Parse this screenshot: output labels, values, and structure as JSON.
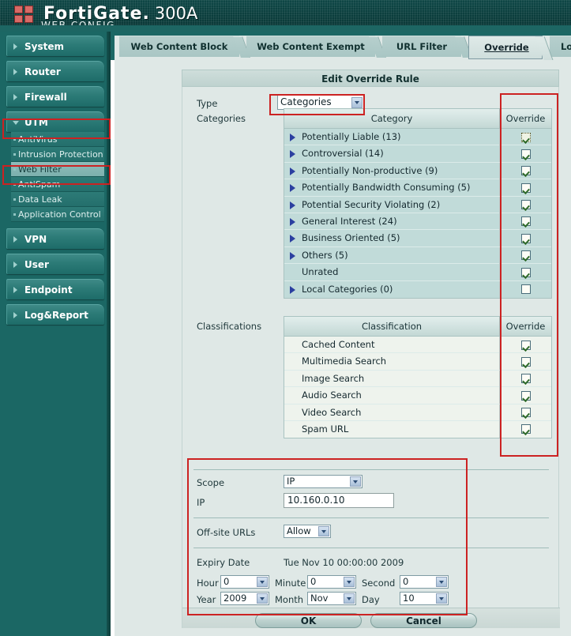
{
  "banner": {
    "brand": "FortiGate.",
    "model": "300A",
    "subtitle": "WEB CONFIG",
    "logo_icon": "fortinet-squares-logo-icon"
  },
  "sidebar": {
    "groups": [
      {
        "label": "System",
        "expanded": false,
        "highlighted": false,
        "children": []
      },
      {
        "label": "Router",
        "expanded": false,
        "highlighted": false,
        "children": []
      },
      {
        "label": "Firewall",
        "expanded": false,
        "highlighted": false,
        "children": []
      },
      {
        "label": "UTM",
        "expanded": true,
        "highlighted": true,
        "children": [
          {
            "label": "AntiVirus",
            "active": false,
            "highlighted": false
          },
          {
            "label": "Intrusion Protection",
            "active": false,
            "highlighted": false
          },
          {
            "label": "Web Filter",
            "active": true,
            "highlighted": true
          },
          {
            "label": "AntiSpam",
            "active": false,
            "highlighted": false
          },
          {
            "label": "Data Leak Prevention",
            "active": false,
            "highlighted": false
          },
          {
            "label": "Application Control",
            "active": false,
            "highlighted": false
          }
        ]
      },
      {
        "label": "VPN",
        "expanded": false,
        "highlighted": false,
        "children": []
      },
      {
        "label": "User",
        "expanded": false,
        "highlighted": false,
        "children": []
      },
      {
        "label": "Endpoint Control",
        "expanded": false,
        "highlighted": false,
        "children": []
      },
      {
        "label": "Log&Report",
        "expanded": false,
        "highlighted": false,
        "children": []
      }
    ]
  },
  "tabs": [
    {
      "label": "Web Content Block",
      "selected": false
    },
    {
      "label": "Web Content Exempt",
      "selected": false
    },
    {
      "label": "URL Filter",
      "selected": false
    },
    {
      "label": "Override",
      "selected": true
    },
    {
      "label": "Loc",
      "selected": false
    }
  ],
  "panel": {
    "title": "Edit Override Rule",
    "type_label": "Type",
    "type_value": "Categories",
    "categories_label": "Categories",
    "classifications_label": "Classifications",
    "categories_table": {
      "col_name": "Category",
      "col_override": "Override",
      "rows": [
        {
          "label": "Potentially Liable (13)",
          "expandable": true,
          "checked": true,
          "focused": true
        },
        {
          "label": "Controversial (14)",
          "expandable": true,
          "checked": true,
          "focused": false
        },
        {
          "label": "Potentially Non-productive (9)",
          "expandable": true,
          "checked": true,
          "focused": false
        },
        {
          "label": "Potentially Bandwidth Consuming (5)",
          "expandable": true,
          "checked": true,
          "focused": false
        },
        {
          "label": "Potential Security Violating (2)",
          "expandable": true,
          "checked": true,
          "focused": false
        },
        {
          "label": "General Interest (24)",
          "expandable": true,
          "checked": true,
          "focused": false
        },
        {
          "label": "Business Oriented (5)",
          "expandable": true,
          "checked": true,
          "focused": false
        },
        {
          "label": "Others (5)",
          "expandable": true,
          "checked": true,
          "focused": false
        },
        {
          "label": "Unrated",
          "expandable": false,
          "checked": true,
          "focused": false
        },
        {
          "label": "Local Categories (0)",
          "expandable": true,
          "checked": false,
          "focused": false
        }
      ]
    },
    "classifications_table": {
      "col_name": "Classification",
      "col_override": "Override",
      "rows": [
        {
          "label": "Cached Content",
          "checked": true
        },
        {
          "label": "Multimedia Search",
          "checked": true
        },
        {
          "label": "Image Search",
          "checked": true
        },
        {
          "label": "Audio Search",
          "checked": true
        },
        {
          "label": "Video Search",
          "checked": true
        },
        {
          "label": "Spam URL",
          "checked": true
        }
      ]
    },
    "scope_label": "Scope",
    "scope_value": "IP",
    "ip_label": "IP",
    "ip_value": "10.160.0.10",
    "offsite_label": "Off-site URLs",
    "offsite_value": "Allow",
    "expiry_label": "Expiry Date",
    "expiry_value": "Tue Nov 10 00:00:00 2009",
    "hour_label": "Hour",
    "hour_value": "0",
    "minute_label": "Minute",
    "minute_value": "0",
    "second_label": "Second",
    "second_value": "0",
    "year_label": "Year",
    "year_value": "2009",
    "month_label": "Month",
    "month_value": "Nov",
    "day_label": "Day",
    "day_value": "10",
    "ok_label": "OK",
    "cancel_label": "Cancel"
  },
  "colors": {
    "banner": "#0b3d3c",
    "nav": "#1b6764",
    "annotation": "#cc2222",
    "content_bg": "#dfe8e6"
  }
}
